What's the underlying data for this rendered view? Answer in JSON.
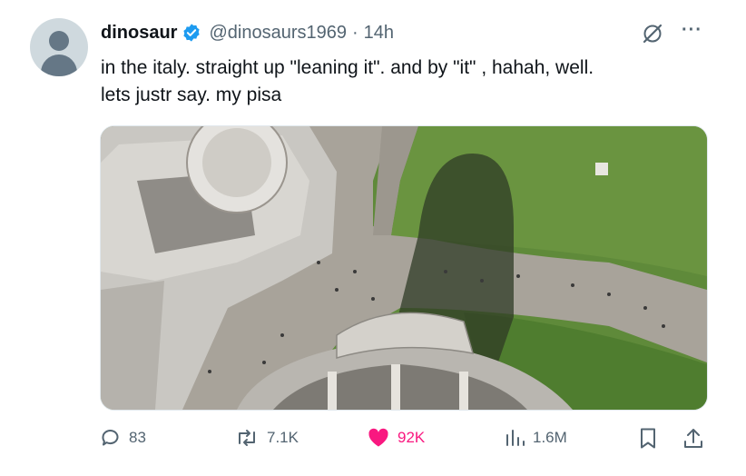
{
  "author": {
    "name": "dinosaur",
    "handle": "@dinosaurs1969",
    "separator": "·",
    "time": "14h",
    "verified": true
  },
  "tweet": {
    "line1": "in the italy. straight up \"leaning it\". and by \"it\" , hahah, well.",
    "line2": "lets justr say. my pisa"
  },
  "menu": {
    "more": "···"
  },
  "actions": {
    "replies": "83",
    "reposts": "7.1K",
    "likes": "92K",
    "views": "1.6M"
  },
  "colors": {
    "like": "#f91880",
    "muted": "#536471",
    "verified": "#1d9bf0"
  },
  "icons": [
    "reply-icon",
    "repost-icon",
    "heart-icon",
    "views-icon",
    "bookmark-icon",
    "share-icon",
    "grok-icon",
    "more-icon",
    "verified-badge-icon"
  ]
}
